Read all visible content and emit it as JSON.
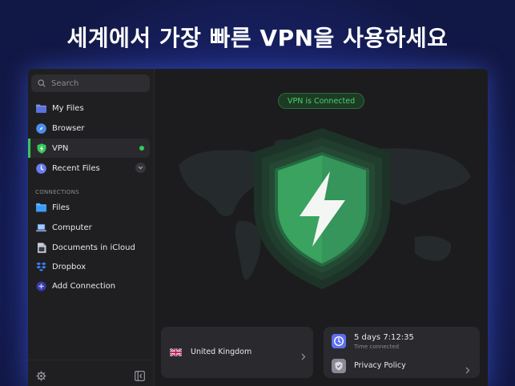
{
  "headline": "세계에서 가장 빠른 VPN을 사용하세요",
  "sidebar": {
    "search_placeholder": "Search",
    "items": [
      {
        "label": "My Files",
        "icon": "folder-icon"
      },
      {
        "label": "Browser",
        "icon": "compass-icon"
      },
      {
        "label": "VPN",
        "icon": "shield-bolt-icon",
        "active": true,
        "status": "connected"
      },
      {
        "label": "Recent Files",
        "icon": "clock-icon"
      }
    ],
    "connections_label": "CONNECTIONS",
    "connections": [
      {
        "label": "Files",
        "icon": "folder-icon"
      },
      {
        "label": "Computer",
        "icon": "laptop-icon"
      },
      {
        "label": "Documents in iCloud",
        "icon": "document-icon"
      },
      {
        "label": "Dropbox",
        "icon": "dropbox-icon"
      },
      {
        "label": "Add Connection",
        "icon": "plus-circle-icon"
      }
    ]
  },
  "main": {
    "status": "VPN is Connected",
    "location": {
      "country": "United Kingdom",
      "flag": "uk-flag-icon"
    },
    "session": {
      "duration": "5 days 7:12:35",
      "caption": "Time connected"
    },
    "privacy_link": "Privacy Policy"
  },
  "colors": {
    "accent_green": "#35c95a",
    "shield_green": "#3aa35f",
    "background_blue": "#1a2470"
  }
}
